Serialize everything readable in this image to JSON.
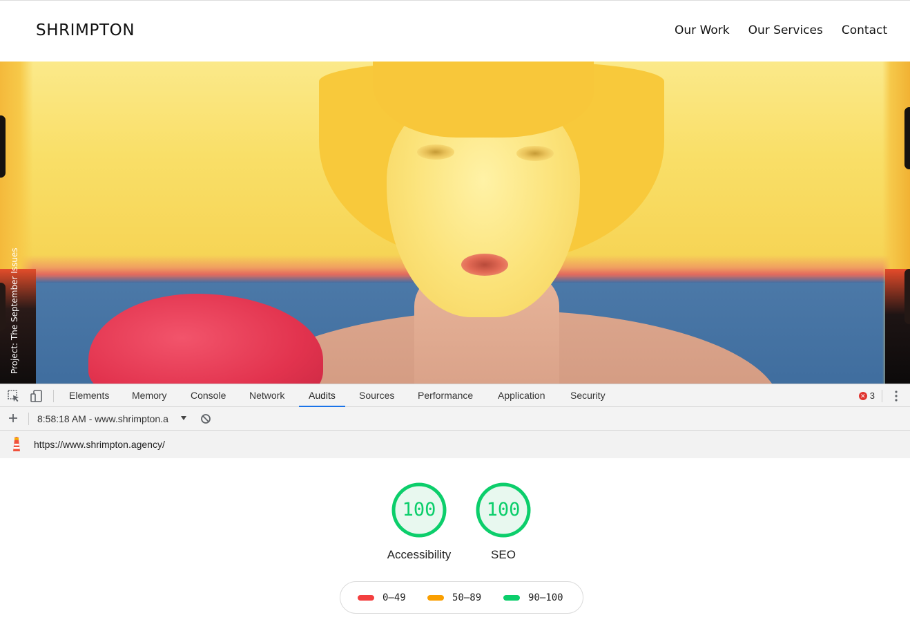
{
  "site": {
    "brand": "SHRIMPTON",
    "nav": [
      "Our Work",
      "Our Services",
      "Contact"
    ],
    "hero_caption": "Project: The September Issues"
  },
  "devtools": {
    "tabs": [
      "Elements",
      "Memory",
      "Console",
      "Network",
      "Audits",
      "Sources",
      "Performance",
      "Application",
      "Security"
    ],
    "active_tab": "Audits",
    "error_count": "3",
    "error_icon_glyph": "✕"
  },
  "audits": {
    "report_select": "8:58:18 AM - www.shrimpton.a",
    "url": "https://www.shrimpton.agency/",
    "scores": [
      {
        "label": "Accessibility",
        "value": "100"
      },
      {
        "label": "SEO",
        "value": "100"
      }
    ],
    "legend": [
      {
        "range": "0–49",
        "color": "#f33f3f"
      },
      {
        "range": "50–89",
        "color": "#fa9f00"
      },
      {
        "range": "90–100",
        "color": "#0cce6b"
      }
    ],
    "pass_color": "#0cce6b"
  }
}
